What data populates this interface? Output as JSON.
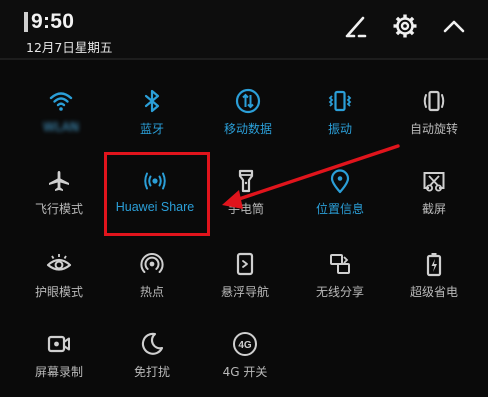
{
  "status": {
    "time": "9:50",
    "date": "12月7日星期五",
    "actions": [
      {
        "name": "edit-button",
        "icon": "edit-pencil-icon"
      },
      {
        "name": "settings-button",
        "icon": "gear-icon"
      },
      {
        "name": "collapse-button",
        "icon": "chevron-up-icon"
      }
    ]
  },
  "tiles": [
    {
      "key": "wifi",
      "label": "WLAN",
      "icon": "wifi-icon",
      "on": true,
      "blurred": true
    },
    {
      "key": "bluetooth",
      "label": "蓝牙",
      "icon": "bluetooth-icon",
      "on": true
    },
    {
      "key": "mobile-data",
      "label": "移动数据",
      "icon": "mobile-data-icon",
      "on": true
    },
    {
      "key": "vibrate",
      "label": "振动",
      "icon": "vibrate-icon",
      "on": true
    },
    {
      "key": "auto-rotate",
      "label": "自动旋转",
      "icon": "auto-rotate-icon",
      "on": false
    },
    {
      "key": "airplane",
      "label": "飞行模式",
      "icon": "airplane-icon",
      "on": false
    },
    {
      "key": "huawei-share",
      "label": "Huawei Share",
      "icon": "huawei-share-icon",
      "on": true
    },
    {
      "key": "flashlight",
      "label": "手电筒",
      "icon": "flashlight-icon",
      "on": false
    },
    {
      "key": "location",
      "label": "位置信息",
      "icon": "location-pin-icon",
      "on": true
    },
    {
      "key": "screenshot",
      "label": "截屏",
      "icon": "screenshot-scissors-icon",
      "on": false
    },
    {
      "key": "eye-comfort",
      "label": "护眼模式",
      "icon": "eye-icon",
      "on": false
    },
    {
      "key": "hotspot",
      "label": "热点",
      "icon": "hotspot-icon",
      "on": false
    },
    {
      "key": "floating-nav",
      "label": "悬浮导航",
      "icon": "floating-nav-icon",
      "on": false
    },
    {
      "key": "wireless-share",
      "label": "无线分享",
      "icon": "wireless-share-icon",
      "on": false
    },
    {
      "key": "power-saver",
      "label": "超级省电",
      "icon": "battery-icon",
      "on": false
    },
    {
      "key": "screen-record",
      "label": "屏幕录制",
      "icon": "screen-record-icon",
      "on": false
    },
    {
      "key": "do-not-disturb",
      "label": "免打扰",
      "icon": "moon-icon",
      "on": false
    },
    {
      "key": "4g-switch",
      "label": "4G 开关",
      "icon": "4g-icon",
      "on": false
    }
  ],
  "colors": {
    "accent": "#2b9fd8",
    "inactive": "#cfcfcf",
    "highlight_box": "#e0141c",
    "background": "#0a0a0a"
  },
  "annotation": {
    "highlight": "huawei-share",
    "arrow": "red-arrow"
  }
}
